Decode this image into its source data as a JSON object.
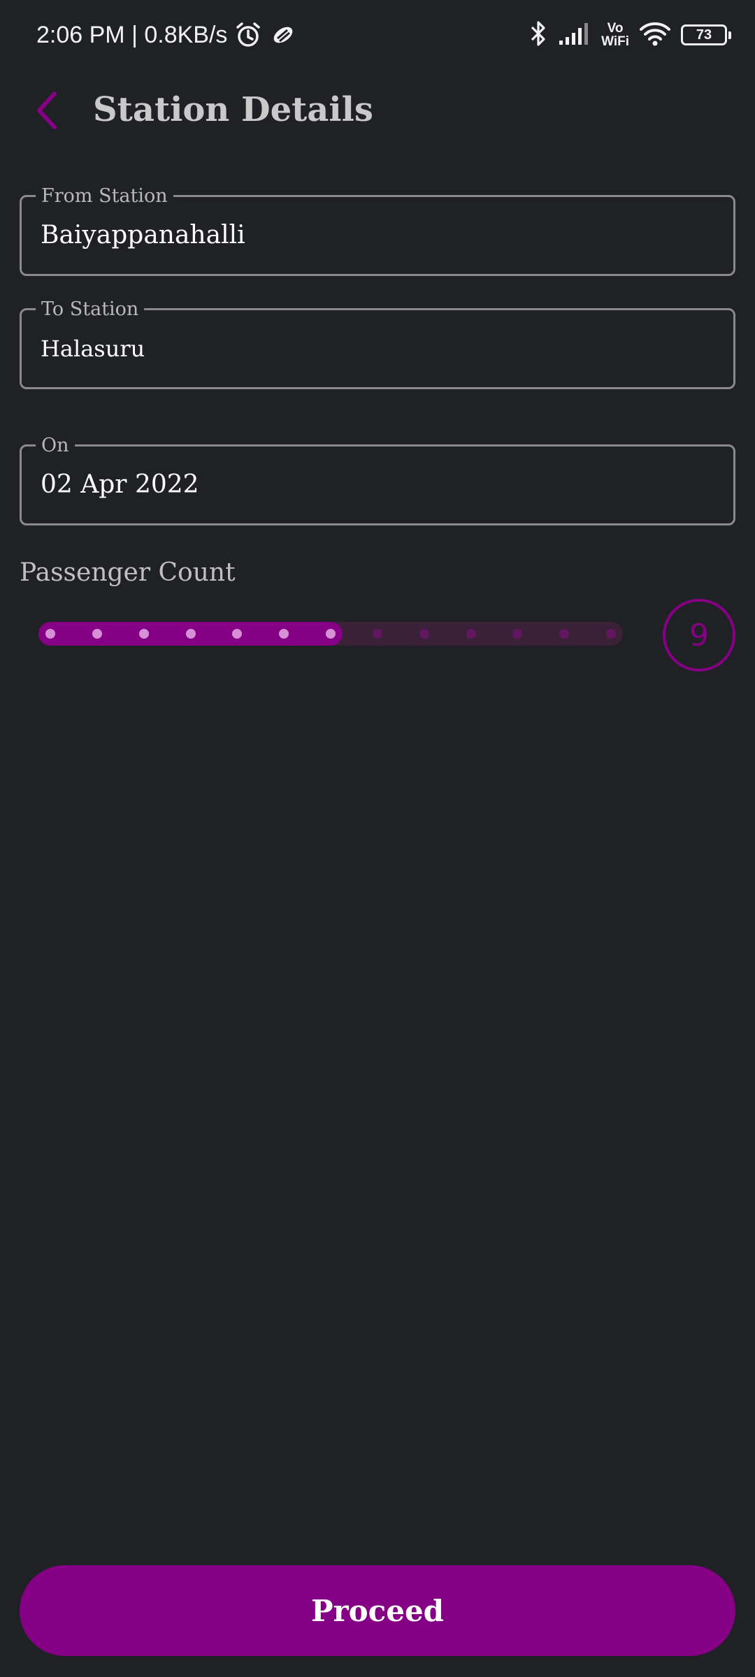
{
  "status_bar": {
    "time_speed": "2:06 PM | 0.8KB/s",
    "vo": "Vo",
    "wifi_label": "WiFi",
    "battery": "73"
  },
  "header": {
    "title": "Station Details"
  },
  "form": {
    "from": {
      "label": "From Station",
      "value": "Baiyappanahalli"
    },
    "to": {
      "label": "To Station",
      "value": "Halasuru"
    },
    "on": {
      "label": "On",
      "value": "02 Apr 2022"
    }
  },
  "passenger": {
    "label": "Passenger Count",
    "count": "9",
    "slider_fraction": 0.52
  },
  "actions": {
    "proceed_label": "Proceed"
  },
  "colors": {
    "accent": "#850085",
    "background": "#202125"
  }
}
